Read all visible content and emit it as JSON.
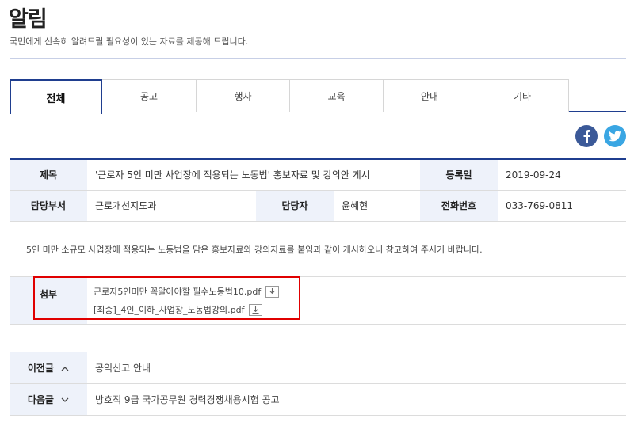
{
  "header": {
    "title": "알림",
    "description": "국민에게 신속히 알려드릴 필요성이 있는 자료를 제공해 드립니다."
  },
  "tabs": [
    {
      "label": "전체",
      "active": true
    },
    {
      "label": "공고",
      "active": false
    },
    {
      "label": "행사",
      "active": false
    },
    {
      "label": "교육",
      "active": false
    },
    {
      "label": "안내",
      "active": false
    },
    {
      "label": "기타",
      "active": false
    }
  ],
  "social": {
    "facebook_icon": "facebook-icon",
    "twitter_icon": "twitter-icon"
  },
  "post": {
    "labels": {
      "title": "제목",
      "reg_date": "등록일",
      "department": "담당부서",
      "manager": "담당자",
      "phone": "전화번호",
      "attachment": "첨부"
    },
    "title": "'근로자 5인 미만 사업장에 적용되는 노동법' 홍보자료 및 강의안 게시",
    "reg_date": "2019-09-24",
    "department": "근로개선지도과",
    "manager": "윤혜현",
    "phone": "033-769-0811",
    "body": "5인 미만 소규모 사업장에 적용되는 노동법을 담은 홍보자료와 강의자료를 붙임과 같이 게시하오니 참고하여 주시기 바랍니다.",
    "attachments": [
      {
        "name": "근로자5인미만 꼭알아야할 필수노동법10.pdf"
      },
      {
        "name": "[최종]_4인_이하_사업장_노동법강의.pdf"
      }
    ]
  },
  "navigation": {
    "prev_label": "이전글",
    "prev_title": "공익신고 안내",
    "next_label": "다음글",
    "next_title": "방호직 9급 국가공무원 경력경쟁채용시험 공고"
  },
  "colors": {
    "accent": "#1f3e8f",
    "header_bg": "#eef2fa",
    "highlight": "#e00000",
    "facebook": "#3b5998",
    "twitter": "#3aa6e3"
  }
}
